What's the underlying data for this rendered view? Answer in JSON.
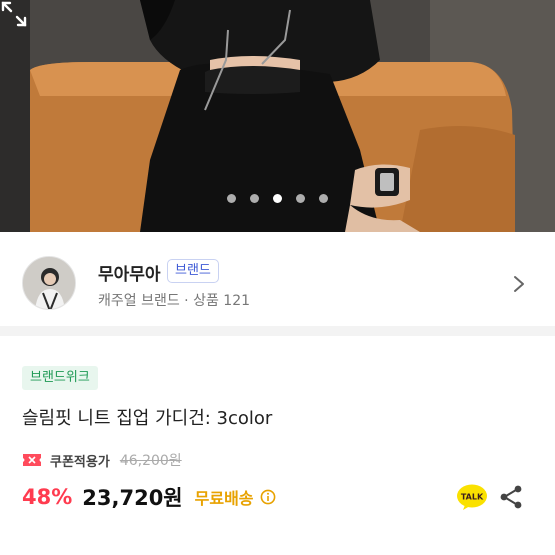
{
  "hero": {
    "slides_total": 5,
    "active_slide": 3,
    "expand_icon": "expand-icon"
  },
  "seller": {
    "name": "무아무아",
    "badge": "브랜드",
    "meta": "캐주얼 브랜드 · 상품 121",
    "chevron_icon": "chevron-right-icon"
  },
  "product": {
    "tag": "브랜드위크",
    "title": "슬림핏 니트 집업 가디건: 3color",
    "coupon_label": "쿠폰적용가",
    "original_price": "46,200원",
    "discount": "48%",
    "price": "23,720원",
    "shipping": "무료배송"
  },
  "icons": {
    "coupon": "coupon-ticket-icon",
    "info": "info-icon",
    "talk": "kakao-talk-icon",
    "share": "share-icon"
  },
  "colors": {
    "discount": "#ff3b4f",
    "shipping": "#e8a200",
    "brand_badge": "#3e5ad6",
    "tag_text": "#1f9a55",
    "talk_bubble": "#fae100"
  }
}
